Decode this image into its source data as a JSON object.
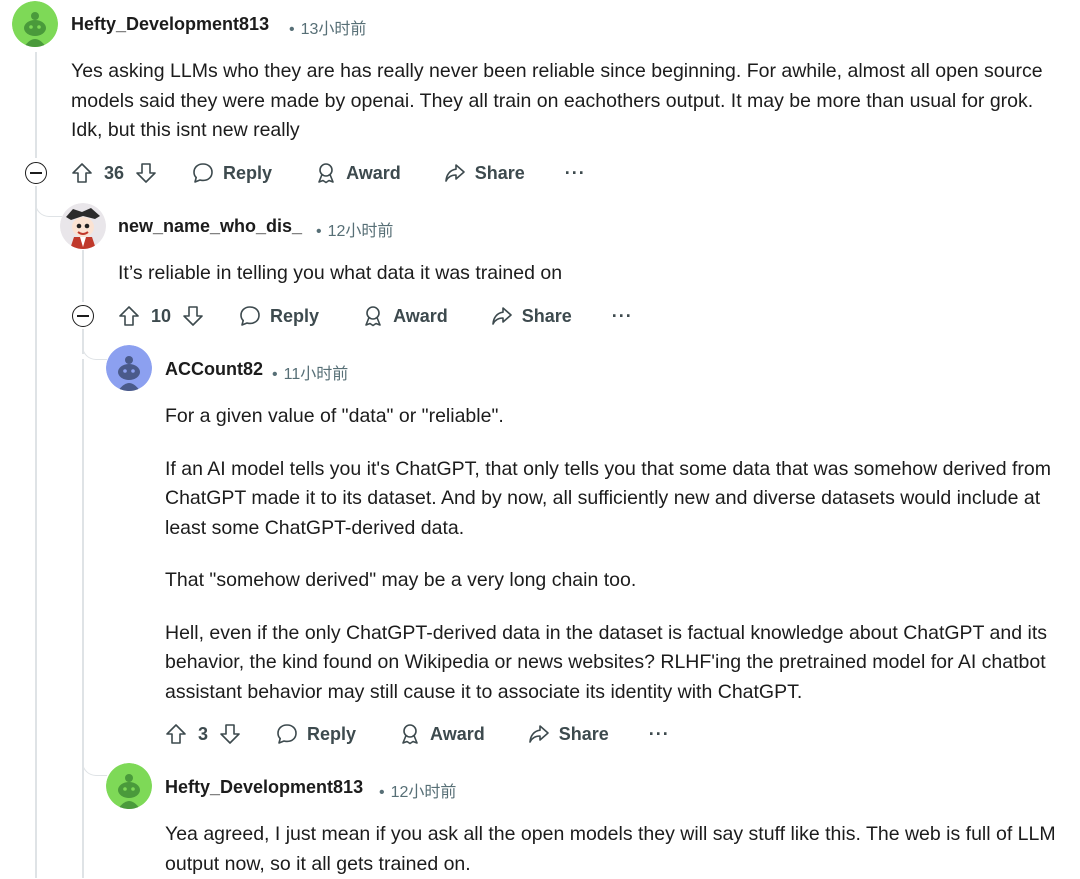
{
  "comments": [
    {
      "author": "Hefty_Development813",
      "time": "13小时前",
      "body": [
        "Yes asking LLMs who they are has really never been reliable since beginning. For awhile, almost all open source models said they were made by openai. They all train on eachothers output. It may be more than usual for grok. Idk, but this isnt new really"
      ],
      "votes": "36",
      "avatar": "green-snoo-avatar"
    },
    {
      "author": "new_name_who_dis_",
      "time": "12小时前",
      "body": [
        "It’s reliable in telling you what data it was trained on"
      ],
      "votes": "10",
      "avatar": "cartoon-avatar"
    },
    {
      "author": "ACCount82",
      "time": "11小时前",
      "body": [
        "For a given value of \"data\" or \"reliable\".",
        "If an AI model tells you it's ChatGPT, that only tells you that some data that was somehow derived from ChatGPT made it to its dataset. And by now, all sufficiently new and diverse datasets would include at least some ChatGPT-derived data.",
        "That \"somehow derived\" may be a very long chain too.",
        "Hell, even if the only ChatGPT-derived data in the dataset is factual knowledge about ChatGPT and its behavior, the kind found on Wikipedia or news websites? RLHF'ing the pretrained model for AI chatbot assistant behavior may still cause it to associate its identity with ChatGPT."
      ],
      "votes": "3",
      "avatar": "blue-snoo-avatar"
    },
    {
      "author": "Hefty_Development813",
      "time": "12小时前",
      "body": [
        "Yea agreed, I just mean if you ask all the open models they will say stuff like this. The web is full of LLM output now, so it all gets trained on."
      ],
      "avatar": "green-snoo-avatar"
    }
  ],
  "actions": {
    "reply": "Reply",
    "award": "Award",
    "share": "Share",
    "more": "···"
  },
  "colors": {
    "green_avatar": "#7ed957",
    "blue_avatar": "#8ca0f0",
    "thread_line": "#dfe3e6",
    "meta_text": "#576f76"
  }
}
